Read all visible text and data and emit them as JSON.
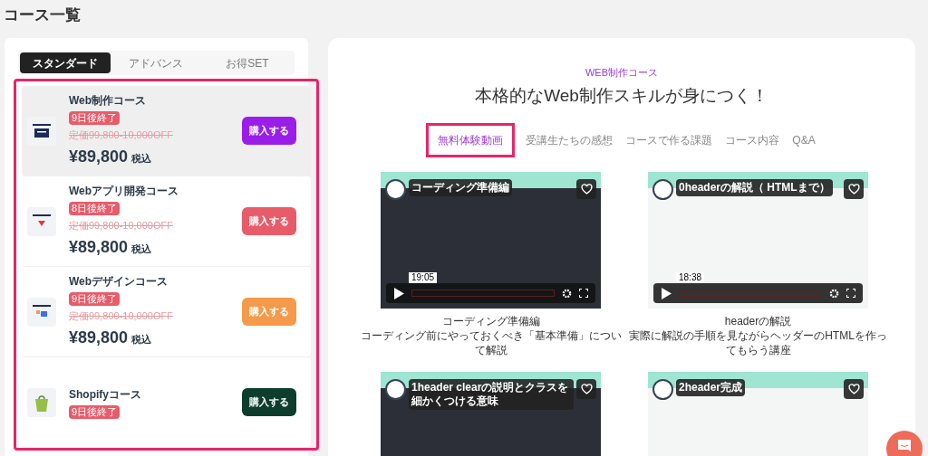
{
  "page_title": "コース一覧",
  "plan_tabs": [
    {
      "label": "スタンダード",
      "selected": true
    },
    {
      "label": "アドバンス",
      "selected": false
    },
    {
      "label": "お得SET",
      "selected": false
    }
  ],
  "courses": [
    {
      "name": "Web制作コース",
      "badge": "9日後終了",
      "old_price": "定価99,800-10,000OFF",
      "price": "¥89,800",
      "tax": "税込",
      "button": "購入する",
      "color": "#9b1de8",
      "kind": "code",
      "selected": true
    },
    {
      "name": "Webアプリ開発コース",
      "badge": "8日後終了",
      "old_price": "定価99,800-10,000OFF",
      "price": "¥89,800",
      "tax": "税込",
      "button": "購入する",
      "color": "#e85c6a",
      "kind": "gem",
      "selected": false
    },
    {
      "name": "Webデザインコース",
      "badge": "9日後終了",
      "old_price": "定価99,800-10,000OFF",
      "price": "¥89,800",
      "tax": "税込",
      "button": "購入する",
      "color": "#f59a4a",
      "kind": "design",
      "selected": false
    },
    {
      "name": "Shopifyコース",
      "badge": "9日後終了",
      "button": "購入する",
      "color": "#0d3d2c",
      "kind": "bag",
      "selected": false
    }
  ],
  "course_header": {
    "eyebrow": "WEB制作コース",
    "title": "本格的なWeb制作スキルが身につく！"
  },
  "section_tabs": [
    {
      "label": "無料体験動画",
      "selected": true
    },
    {
      "label": "受講生たちの感想",
      "selected": false
    },
    {
      "label": "コースで作る課題",
      "selected": false
    },
    {
      "label": "コース内容",
      "selected": false
    },
    {
      "label": "Q&A",
      "selected": false
    }
  ],
  "videos": [
    {
      "overlay_title": "コーディング準備編",
      "duration": "19:05",
      "kind": "code",
      "caption": "コーディング準備編",
      "description": "コーディング前にやっておくべき「基本準備」について解説"
    },
    {
      "overlay_title": "0headerの解説（ HTMLまで）",
      "duration": "18:38",
      "kind": "site",
      "caption": "headerの解説",
      "description": "実際に解説の手順を見ながらヘッダーのHTMLを作ってもらう講座"
    },
    {
      "overlay_title": "1header clearの説明とクラスを細かくつける意味",
      "kind": "code"
    },
    {
      "overlay_title": "2header完成",
      "kind": "site"
    }
  ]
}
